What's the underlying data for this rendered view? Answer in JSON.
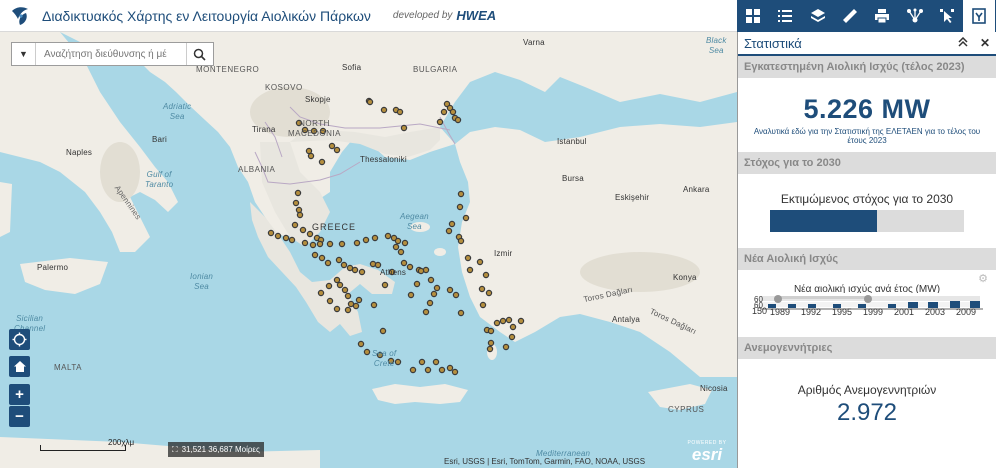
{
  "header": {
    "title": "Διαδικτυακός Χάρτης εν Λειτουργία Αιολικών Πάρκων",
    "developed_by": "developed by",
    "brand": "HWEA"
  },
  "search": {
    "placeholder": "Αναζήτηση διεύθυνσης ή μέ"
  },
  "map": {
    "labels": {
      "varna": "Varna",
      "black_sea": "Black\nSea",
      "montenegro": "MONTENEGRO",
      "sofia": "Sofia",
      "bulgaria": "BULGARIA",
      "kosovo": "KOSOVO",
      "skopje": "Skopje",
      "adriatic": "Adriatic\nSea",
      "bari": "Bari",
      "tirana": "Tirana",
      "north_macedonia": "NORTH\nMACEDONIA",
      "istanbul": "Istanbul",
      "naples": "Naples",
      "thessaloniki": "Thessaloniki",
      "albania": "ALBANIA",
      "bursa": "Bursa",
      "apennines": "Apennines",
      "gulf_taranto": "Gulf of\nTaranto",
      "eskisehir": "Eskişehir",
      "ankara": "Ankara",
      "greece": "GREECE",
      "aegean": "Aegean\nSea",
      "izmir": "Izmir",
      "palermo": "Palermo",
      "ionian": "Ionian\nSea",
      "konya": "Konya",
      "athens": "Athens",
      "toros_1": "Toros Dağları",
      "toros_2": "Toros Dağları",
      "sicilian": "Sicilian\nChannel",
      "antalya": "Antalya",
      "sea_crete": "Sea of\nCrete",
      "malta": "MALTA",
      "nicosia": "Nicosia",
      "cyprus": "CYPRUS",
      "mediterranean": "Mediterranean"
    },
    "scale_text": "200χλμ",
    "coordinates": "31,521 36,687 Μοίρες",
    "attribution": "Esri, USGS | Esri, TomTom, Garmin, FAO, NOAA, USGS",
    "esri_powered": "POWERED BY",
    "esri_logo": "esri"
  },
  "map_buttons": {
    "locate_icon": "locate-icon",
    "home_icon": "home-icon",
    "zoom_in": "+",
    "zoom_out": "−"
  },
  "toolbar": {
    "icons": [
      "grid-icon",
      "list-icon",
      "layers-icon",
      "ruler-icon",
      "print-icon",
      "share-icon",
      "select-icon",
      "statistics-icon"
    ]
  },
  "panel": {
    "title": "Στατιστικά",
    "collapse": "⌃",
    "close": "✕",
    "sections": {
      "installed": {
        "heading": "Εγκατεστημένη Αιολική Ισχύς (τέλος 2023)",
        "value": "5.226 MW",
        "note": "Αναλυτικά εδώ για την Στατιστική της ΕΛΕΤΑΕΝ για το τέλος του έτους 2023"
      },
      "target": {
        "heading": "Στόχος για το 2030",
        "label": "Εκτιμώμενος στόχος για το 2030",
        "progress_fraction": 0.55
      },
      "new_power": {
        "heading": "Νέα Αιολική Ισχύς",
        "chart_title": "Νέα αιολική ισχύς ανά έτος (MW)",
        "axis_left": "150",
        "axis_top_1": "60",
        "axis_top_2": "60",
        "years": [
          "1989",
          "1992",
          "1995",
          "1999",
          "2001",
          "2003",
          "2009"
        ]
      },
      "turbines": {
        "heading": "Ανεμογεννήτριες",
        "label": "Αριθμός Ανεμογεννητριών",
        "value": "2.972"
      }
    }
  },
  "colors": {
    "primary": "#1e4d7a",
    "sea": "#a9d7e6",
    "land": "#f0ede6",
    "greece": "#e8e6df",
    "turkey_mountain": "#e6e4dc",
    "marker_fill": "#b58f3e",
    "marker_stroke": "#3a3a3a"
  }
}
